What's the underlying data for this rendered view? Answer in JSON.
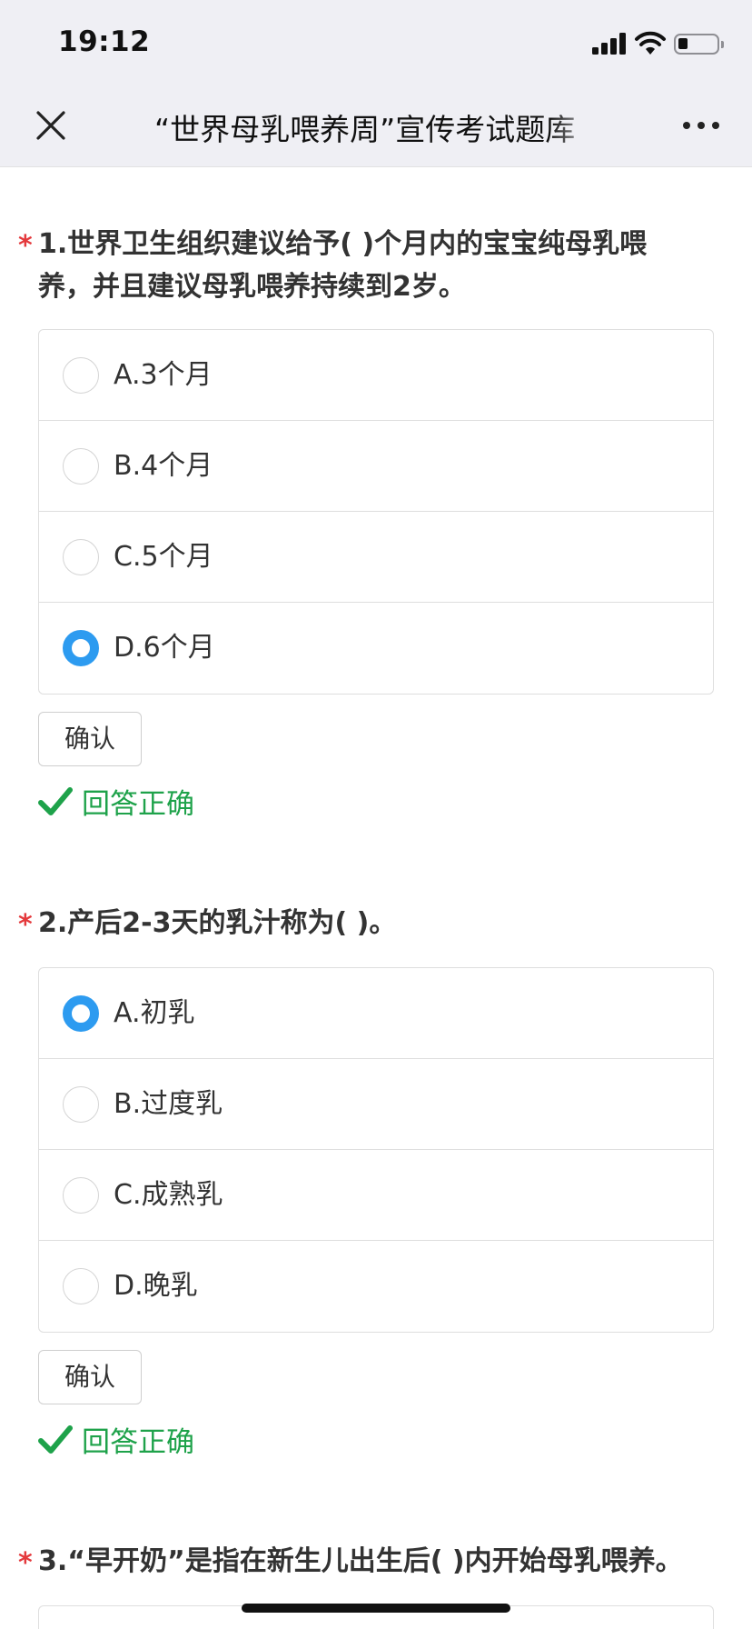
{
  "status_bar": {
    "time": "19:12"
  },
  "nav": {
    "title": "“世界母乳喂养周”宣传考试题库"
  },
  "questions": [
    {
      "star": "*",
      "title": "1.世界卫生组织建议给予( )个月内的宝宝纯母乳喂养，并且建议母乳喂养持续到2岁。",
      "options": [
        "A.3个月",
        "B.4个月",
        "C.5个月",
        "D.6个月"
      ],
      "selected": "D.6个月",
      "confirm_label": "确认",
      "result": "回答正确"
    },
    {
      "star": "*",
      "title": "2.产后2-3天的乳汁称为( )。",
      "options": [
        "A.初乳",
        "B.过度乳",
        "C.成熟乳",
        "D.晚乳"
      ],
      "selected": "A.初乳",
      "confirm_label": "确认",
      "result": "回答正确"
    },
    {
      "star": "*",
      "title": "3.“早开奶”是指在新生儿出生后( )内开始母乳喂养。"
    }
  ],
  "colors": {
    "accent": "#2d9bf0",
    "success": "#1ea24a",
    "required": "#e4393c"
  }
}
